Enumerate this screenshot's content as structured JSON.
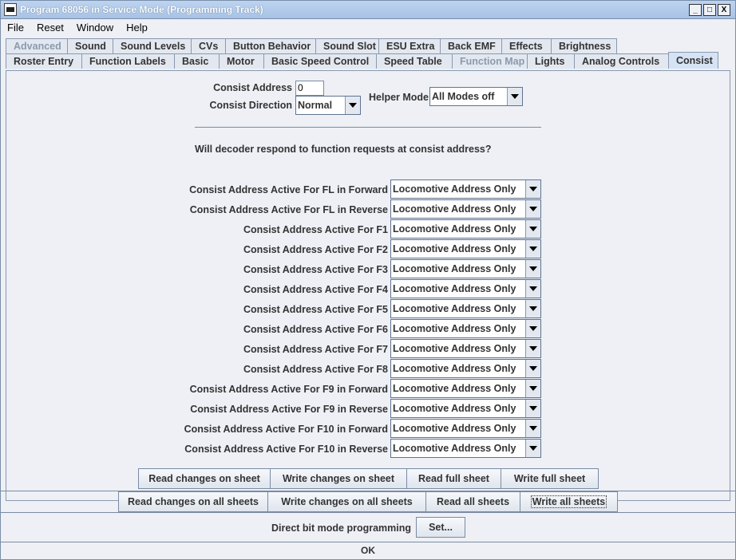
{
  "window": {
    "title": "Program 68056 in Service Mode (Programming Track)",
    "controls": [
      "_",
      "□",
      "X"
    ]
  },
  "menu": [
    "File",
    "Reset",
    "Window",
    "Help"
  ],
  "tabs_row1": [
    {
      "label": "Advanced",
      "disabled": true
    },
    {
      "label": "Sound"
    },
    {
      "label": "Sound Levels"
    },
    {
      "label": "CVs"
    },
    {
      "label": "Button Behavior"
    },
    {
      "label": "Sound Slot"
    },
    {
      "label": "ESU Extra"
    },
    {
      "label": "Back EMF"
    },
    {
      "label": "Effects"
    },
    {
      "label": "Brightness"
    }
  ],
  "tabs_row2": [
    {
      "label": "Roster Entry"
    },
    {
      "label": "Function Labels"
    },
    {
      "label": "Basic"
    },
    {
      "label": "Motor"
    },
    {
      "label": "Basic Speed Control"
    },
    {
      "label": "Speed Table"
    },
    {
      "label": "Function Map",
      "disabled": true
    },
    {
      "label": "Lights"
    },
    {
      "label": "Analog Controls"
    },
    {
      "label": "Consist",
      "selected": true
    }
  ],
  "consist": {
    "address_label": "Consist Address",
    "address_value": "0",
    "direction_label": "Consist Direction",
    "direction_value": "Normal",
    "helper_label": "Helper Mode",
    "helper_value": "All Modes off",
    "question": "Will decoder respond to function requests at consist address?"
  },
  "function_rows": [
    {
      "label": "Consist Address Active For FL in Forward",
      "value": "Locomotive Address Only"
    },
    {
      "label": "Consist Address Active For FL in Reverse",
      "value": "Locomotive Address Only"
    },
    {
      "label": "Consist Address Active For F1",
      "value": "Locomotive Address Only"
    },
    {
      "label": "Consist Address Active For F2",
      "value": "Locomotive Address Only"
    },
    {
      "label": "Consist Address Active For F3",
      "value": "Locomotive Address Only"
    },
    {
      "label": "Consist Address Active For F4",
      "value": "Locomotive Address Only"
    },
    {
      "label": "Consist Address Active For F5",
      "value": "Locomotive Address Only"
    },
    {
      "label": "Consist Address Active For F6",
      "value": "Locomotive Address Only"
    },
    {
      "label": "Consist Address Active For F7",
      "value": "Locomotive Address Only"
    },
    {
      "label": "Consist Address Active For F8",
      "value": "Locomotive Address Only"
    },
    {
      "label": "Consist Address Active For F9 in Forward",
      "value": "Locomotive Address Only"
    },
    {
      "label": "Consist Address Active For F9 in Reverse",
      "value": "Locomotive Address Only"
    },
    {
      "label": "Consist Address Active For F10 in Forward",
      "value": "Locomotive Address Only"
    },
    {
      "label": "Consist Address Active For F10 in Reverse",
      "value": "Locomotive Address Only"
    }
  ],
  "sheet_buttons": [
    "Read changes on sheet",
    "Write changes on sheet",
    "Read full sheet",
    "Write full sheet"
  ],
  "all_buttons": [
    "Read changes on all sheets",
    "Write changes on all sheets",
    "Read all sheets",
    "Write all sheets"
  ],
  "direct_bit": {
    "label": "Direct bit mode programming",
    "button": "Set..."
  },
  "ok_label": "OK",
  "colors": {
    "title_bar": "#a8c2e6",
    "background": "#eef0f5",
    "selected_tab": "#d6e3f5"
  }
}
